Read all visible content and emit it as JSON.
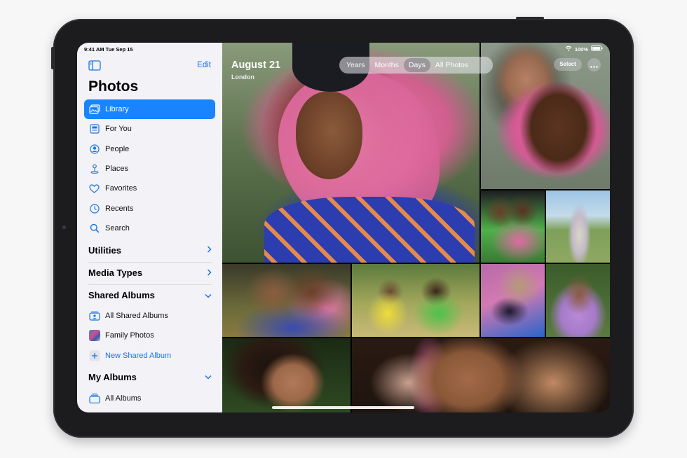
{
  "status": {
    "time_date": "9:41 AM  Tue Sep 15",
    "battery": "100%"
  },
  "sidebar": {
    "edit_label": "Edit",
    "title": "Photos",
    "items": [
      {
        "label": "Library",
        "icon": "library-icon",
        "active": true
      },
      {
        "label": "For You",
        "icon": "for-you-icon"
      },
      {
        "label": "People",
        "icon": "people-icon"
      },
      {
        "label": "Places",
        "icon": "places-icon"
      },
      {
        "label": "Favorites",
        "icon": "heart-icon"
      },
      {
        "label": "Recents",
        "icon": "clock-icon"
      },
      {
        "label": "Search",
        "icon": "search-icon"
      }
    ],
    "sections": {
      "utilities": "Utilities",
      "media_types": "Media Types",
      "shared_albums": "Shared Albums",
      "my_albums": "My Albums"
    },
    "shared": {
      "all_shared": "All Shared Albums",
      "family": "Family Photos",
      "new_shared": "New Shared Album"
    },
    "albums": {
      "all_albums": "All Albums"
    }
  },
  "main": {
    "date_title": "August 21",
    "location": "London",
    "tabs": [
      {
        "label": "Years"
      },
      {
        "label": "Months"
      },
      {
        "label": "Days",
        "active": true
      },
      {
        "label": "All Photos"
      }
    ],
    "select_label": "Select"
  },
  "colors": {
    "accent": "#1a84ff",
    "link": "#1a73e8",
    "sidebar_bg": "#f2f2f7"
  }
}
